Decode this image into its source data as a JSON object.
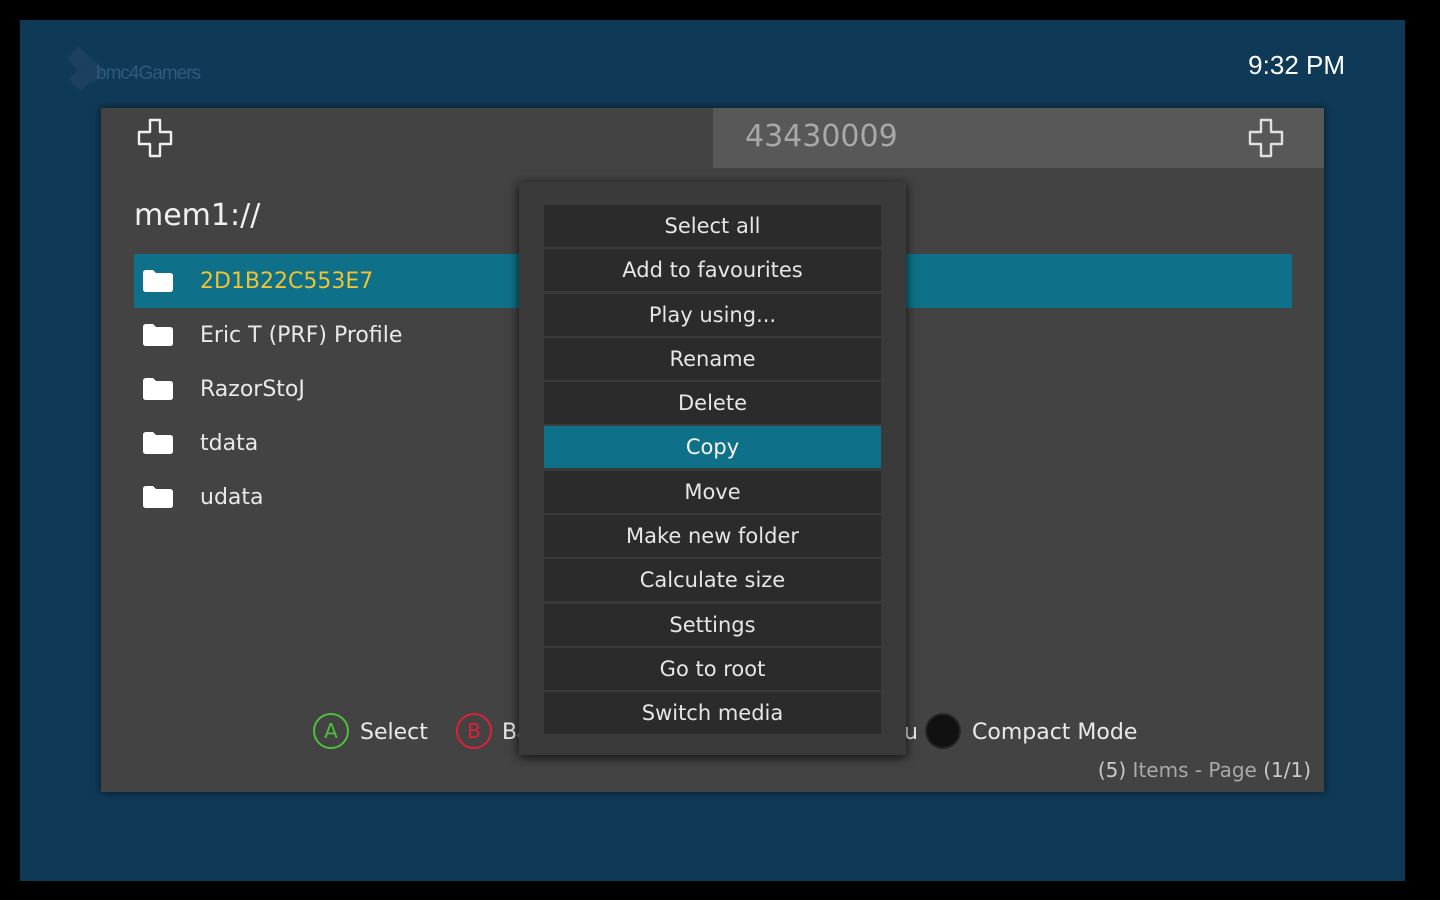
{
  "brand": {
    "logo_text": "bmc4Gamers"
  },
  "clock": "9:32 PM",
  "header": {
    "right_title": "43430009"
  },
  "location": {
    "path": "mem1://"
  },
  "files": [
    {
      "name": "2D1B22C553E7",
      "selected": true
    },
    {
      "name": "Eric T (PRF) Profile",
      "selected": false
    },
    {
      "name": "RazorStoJ",
      "selected": false
    },
    {
      "name": "tdata",
      "selected": false
    },
    {
      "name": "udata",
      "selected": false
    }
  ],
  "footer": {
    "a_glyph": "A",
    "a_label": "Select",
    "b_glyph": "B",
    "b_label_partial": "Ba",
    "menu_partial": "u",
    "black_label": "Compact Mode"
  },
  "status": {
    "count": "(5)",
    "items_word": "Items - Page",
    "page": "(1/1)"
  },
  "context_menu": {
    "items": [
      "Select all",
      "Add to favourites",
      "Play using...",
      "Rename",
      "Delete",
      "Copy",
      "Move",
      "Make new folder",
      "Calculate size",
      "Settings",
      "Go to root",
      "Switch media"
    ],
    "active": "Copy"
  },
  "colors": {
    "accent": "#0e7189",
    "selected_text": "#f2c230",
    "background": "#0f3a57",
    "panel": "#434343"
  },
  "icons": {
    "header": "dpad-icon",
    "folder": "folder-icon"
  }
}
